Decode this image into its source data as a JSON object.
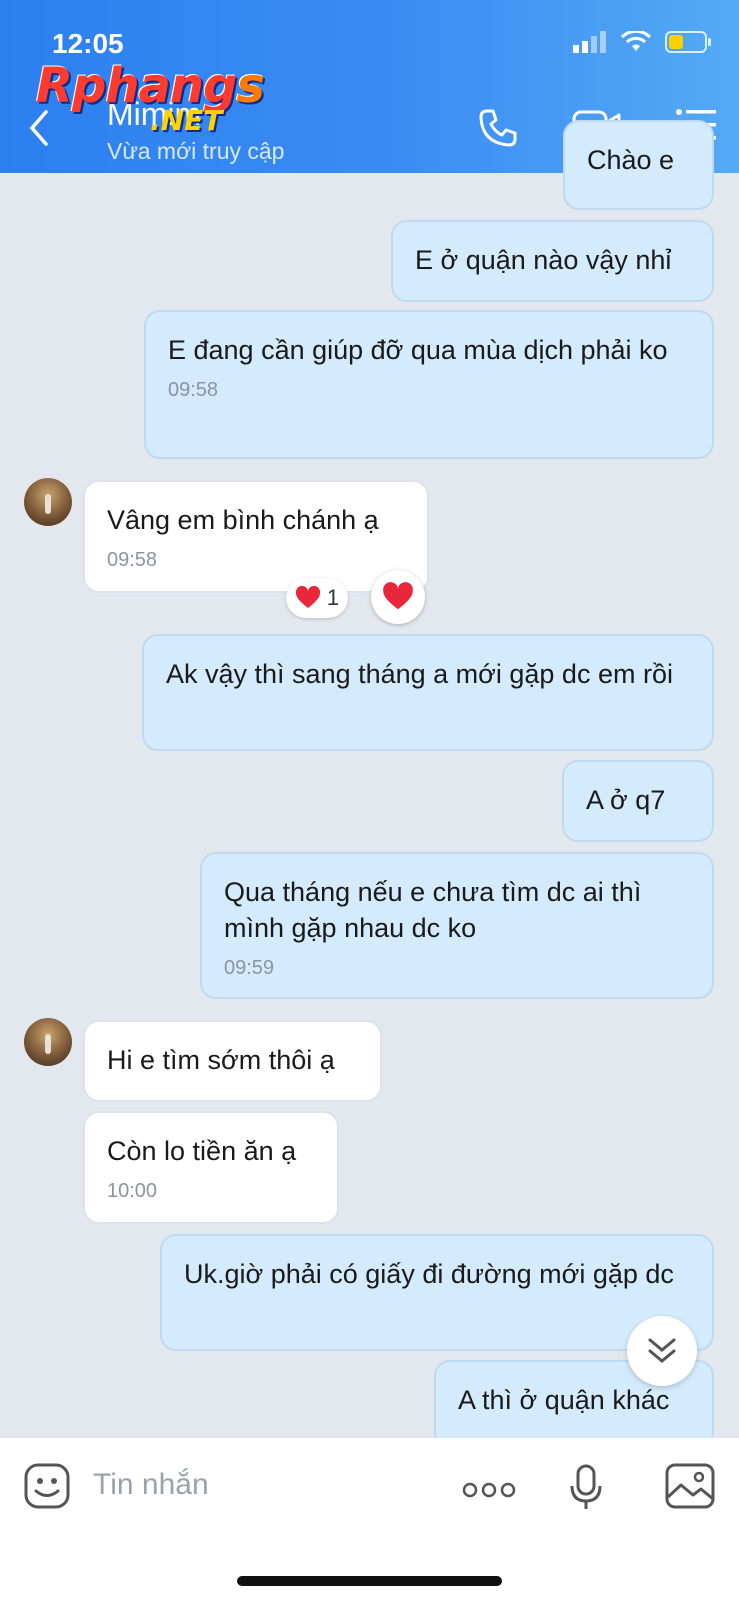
{
  "status_bar": {
    "time": "12:05"
  },
  "watermark": {
    "brand": "Rphangs",
    "suffix": ".NET"
  },
  "header": {
    "contact_name": "Mimim",
    "contact_status": "Vừa mới truy cập"
  },
  "messages": [
    {
      "from": "me",
      "text": "Chào e",
      "time": ""
    },
    {
      "from": "me",
      "text": "E ở quận nào vậy nhỉ",
      "time": ""
    },
    {
      "from": "me",
      "text": "E đang cần giúp đỡ qua mùa dịch phải ko",
      "time": "09:58"
    },
    {
      "from": "them",
      "text": "Vâng em bình chánh ạ",
      "time": "09:58",
      "reaction_count": "1"
    },
    {
      "from": "me",
      "text": "Ak vậy thì sang tháng a mới gặp dc em rồi",
      "time": ""
    },
    {
      "from": "me",
      "text": "A ở q7",
      "time": ""
    },
    {
      "from": "me",
      "text": "Qua tháng nếu e chưa tìm dc ai thì mình gặp nhau dc ko",
      "time": "09:59"
    },
    {
      "from": "them",
      "text": "Hi e tìm sớm thôi ạ",
      "time": ""
    },
    {
      "from": "them",
      "text": "Còn lo tiền ăn ạ",
      "time": "10:00"
    },
    {
      "from": "me",
      "text": "Uk.giờ phải có giấy đi đường mới gặp dc",
      "time": ""
    },
    {
      "from": "me",
      "text": "A thì ở quận khác",
      "time": ""
    }
  ],
  "composer": {
    "placeholder": "Tin nhắn"
  },
  "colors": {
    "header_start": "#2d7ff0",
    "header_end": "#55aaf5",
    "outgoing_bubble": "#d3ebfc",
    "incoming_bubble": "#ffffff",
    "background": "#e3e7ee"
  },
  "icons": [
    "back-icon",
    "phone-icon",
    "video-call-icon",
    "menu-icon",
    "heart-icon",
    "chevron-double-down-icon",
    "sticker-icon",
    "more-icon",
    "microphone-icon",
    "image-icon"
  ]
}
